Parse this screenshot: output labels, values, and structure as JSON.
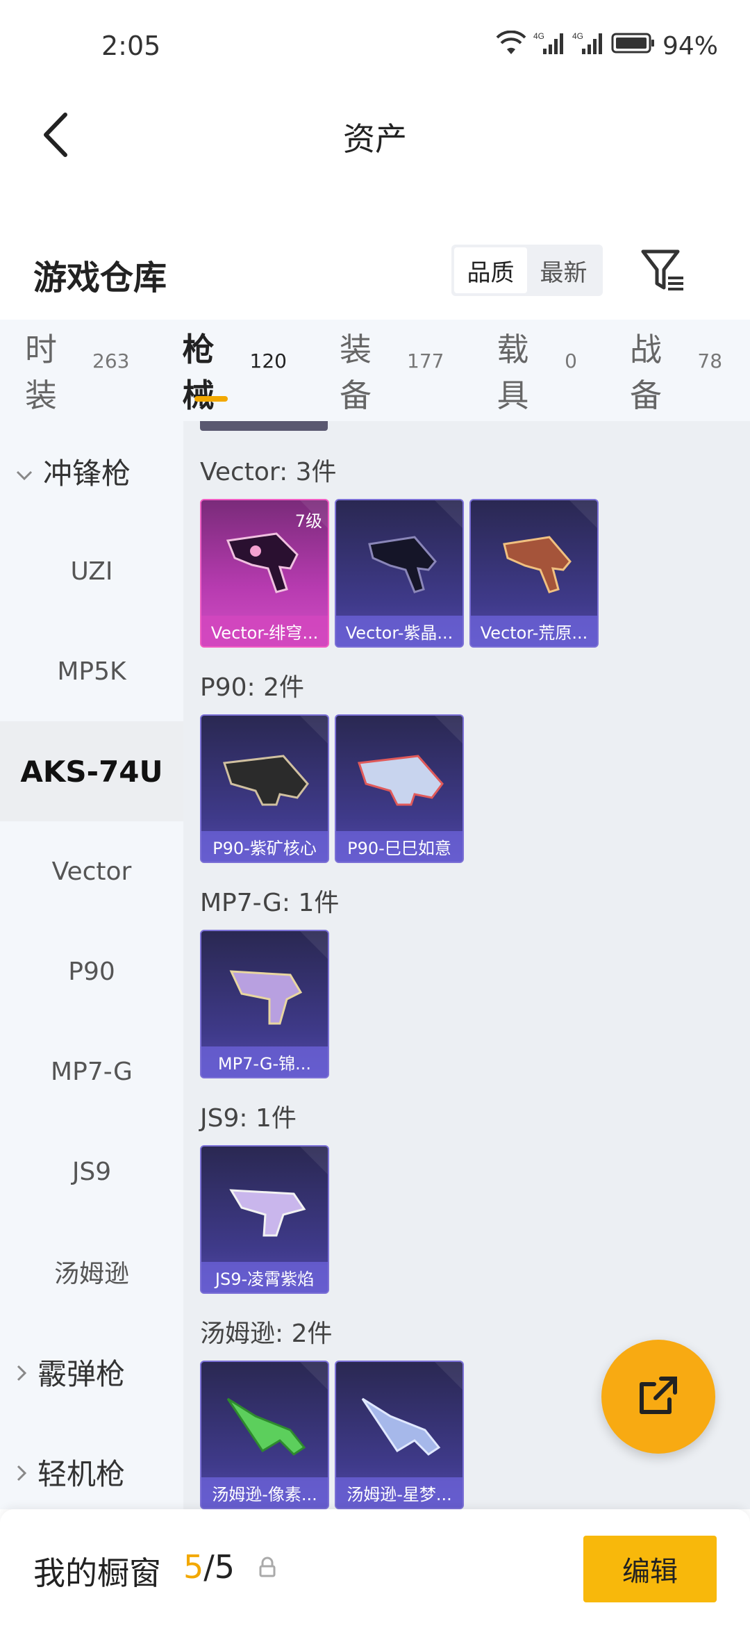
{
  "status_bar": {
    "time": "2:05",
    "battery": "94%",
    "network_1": "4G",
    "network_2": "4G"
  },
  "header": {
    "title": "资产"
  },
  "warehouse": {
    "title": "游戏仓库",
    "sort_options": [
      "品质",
      "最新"
    ],
    "sort_selected": "品质"
  },
  "tabs": [
    {
      "label": "时装",
      "count": "263"
    },
    {
      "label": "枪械",
      "count": "120"
    },
    {
      "label": "装备",
      "count": "177"
    },
    {
      "label": "载具",
      "count": "0"
    },
    {
      "label": "战备",
      "count": "78"
    }
  ],
  "active_tab": "枪械",
  "sidebar": {
    "items": [
      {
        "label": "冲锋枪",
        "type": "group",
        "expanded": true
      },
      {
        "label": "UZI",
        "type": "item"
      },
      {
        "label": "MP5K",
        "type": "item"
      },
      {
        "label": "AKS-74U",
        "type": "item",
        "active": true
      },
      {
        "label": "Vector",
        "type": "item"
      },
      {
        "label": "P90",
        "type": "item"
      },
      {
        "label": "MP7-G",
        "type": "item"
      },
      {
        "label": "JS9",
        "type": "item"
      },
      {
        "label": "汤姆逊",
        "type": "item"
      },
      {
        "label": "霰弹枪",
        "type": "group",
        "expanded": false
      },
      {
        "label": "轻机枪",
        "type": "group",
        "expanded": false
      }
    ]
  },
  "groups": [
    {
      "title": "Vector: 3件",
      "cards": [
        {
          "name": "Vector-绯穹...",
          "level": "7级",
          "rarity": "pink"
        },
        {
          "name": "Vector-紫晶...",
          "rarity": "purple"
        },
        {
          "name": "Vector-荒原...",
          "rarity": "purple"
        }
      ]
    },
    {
      "title": "P90: 2件",
      "cards": [
        {
          "name": "P90-紫矿核心",
          "rarity": "purple"
        },
        {
          "name": "P90-巳巳如意",
          "rarity": "purple"
        }
      ]
    },
    {
      "title": "MP7-G: 1件",
      "cards": [
        {
          "name": "MP7-G-锦...",
          "rarity": "purple"
        }
      ]
    },
    {
      "title": "JS9: 1件",
      "cards": [
        {
          "name": "JS9-凌霄紫焰",
          "rarity": "purple"
        }
      ]
    },
    {
      "title": "汤姆逊: 2件",
      "cards": [
        {
          "name": "汤姆逊-像素...",
          "rarity": "purple"
        },
        {
          "name": "汤姆逊-星梦...",
          "rarity": "purple"
        }
      ]
    }
  ],
  "bottom_bar": {
    "title": "我的橱窗",
    "current": "5",
    "separator": "/",
    "max": "5",
    "edit_label": "编辑"
  },
  "colors": {
    "accent": "#f2a800",
    "fab": "#f8aa12",
    "card_purple": "#3f3a8a",
    "card_pink": "#d24fc4"
  }
}
